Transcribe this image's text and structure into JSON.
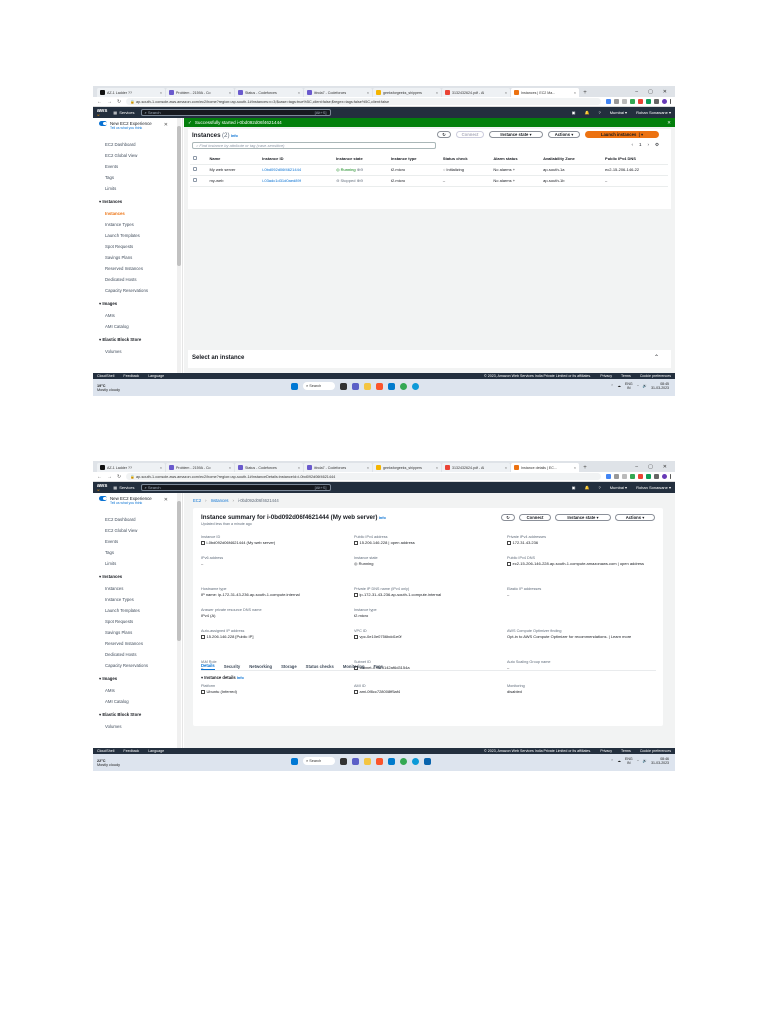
{
  "tabs": [
    {
      "label": "AZ-1 Ladder ??",
      "fav": "#111"
    },
    {
      "label": "Problem - 2159A - Co",
      "fav": "#6a5acd"
    },
    {
      "label": "Status - Codeforces",
      "fav": "#6a5acd"
    },
    {
      "label": "iitrola7 - Codeforces",
      "fav": "#6a5acd"
    },
    {
      "label": "geeksforgeeks_shippers",
      "fav": "#f4b400"
    },
    {
      "label": "3132432624.pdf - Al",
      "fav": "#ea4335"
    },
    {
      "label": "Instances | EC2 Ma...",
      "fav": "#ec7211"
    }
  ],
  "tabs2_active": "Instance details | EC...",
  "url1": "ap-south-1.console.aws.amazon.com/ec2/home?region=ap-south-1#Instances:v=3;$case=tags:true%5C,client:false;$regex=tags:false%5C,client:false",
  "url2": "ap-south-1.console.aws.amazon.com/ec2/home?region=ap-south-1#InstanceDetails:instanceId=i-0bd092d06f4621444",
  "aws": {
    "services": "Services",
    "search": "Search",
    "hotkey": "[Alt+S]",
    "region": "Mumbai",
    "user": "Rohan Sonawane"
  },
  "sidebar": {
    "new_exp": "New EC2 Experience",
    "tell_us": "Tell us what you think",
    "top": [
      "EC2 Dashboard",
      "EC2 Global View",
      "Events",
      "Tags",
      "Limits"
    ],
    "instances_head": "Instances",
    "instances": [
      "Instances",
      "Instance Types",
      "Launch Templates",
      "Spot Requests",
      "Savings Plans",
      "Reserved Instances",
      "Dedicated Hosts",
      "Capacity Reservations"
    ],
    "images_head": "Images",
    "images": [
      "AMIs",
      "AMI Catalog"
    ],
    "ebs_head": "Elastic Block Store",
    "ebs": [
      "Volumes"
    ]
  },
  "shot1": {
    "flash": "Successfully started i-0bd092d06f4621444",
    "title": "Instances",
    "count": "(2)",
    "info": "Info",
    "refresh": "C",
    "connect": "Connect",
    "state_btn": "Instance state",
    "actions": "Actions",
    "launch": "Launch instances",
    "filter": "Find instance by attribute or tag (case-sensitive)",
    "page": "1",
    "columns": [
      "Name",
      "Instance ID",
      "Instance state",
      "Instance type",
      "Status check",
      "Alarm status",
      "Availability Zone",
      "Public IPv4 DNS"
    ],
    "rows": [
      {
        "name": "My web server",
        "id": "i-0bd092d06f4621444",
        "state": "Running",
        "type": "t2.micro",
        "check": "Initializing",
        "alarm": "No alarms",
        "az": "ap-south-1a",
        "dns": "ec2-15-206-146-22"
      },
      {
        "name": "my-web",
        "id": "i-03adc1d31d0aed89f",
        "state": "Stopped",
        "type": "t2.micro",
        "check": "–",
        "alarm": "No alarms",
        "az": "ap-south-1b",
        "dns": "–"
      }
    ],
    "select": "Select an instance"
  },
  "shot2": {
    "crumbs": [
      "EC2",
      "Instances",
      "i-0bd092d06f4621444"
    ],
    "title": "Instance summary for i-0bd092d06f4621444 (My web server)",
    "info": "Info",
    "updated": "Updated less than a minute ago",
    "connect": "Connect",
    "state_btn": "Instance state",
    "actions": "Actions",
    "fields": {
      "instance_id_l": "Instance ID",
      "instance_id_v": "i-0bd092d06f4621444 (My web server)",
      "public_ip_l": "Public IPv4 address",
      "public_ip_v": "15.206.146.228 | open address",
      "private_ip_l": "Private IPv4 addresses",
      "private_ip_v": "172.31.43.236",
      "ipv6_l": "IPv6 address",
      "ipv6_v": "–",
      "state_l": "Instance state",
      "state_v": "Running",
      "pubdns_l": "Public IPv4 DNS",
      "pubdns_v": "ec2-15-206-146-228.ap-south-1.compute.amazonaws.com | open address",
      "hostname_l": "Hostname type",
      "hostname_v": "IP name: ip-172-31-43-236.ap-south-1.compute.internal",
      "privdns_l": "Private IP DNS name (IPv4 only)",
      "privdns_v": "ip-172-31-43-236.ap-south-1.compute.internal",
      "eip_l": "Elastic IP addresses",
      "eip_v": "–",
      "answer_l": "Answer private resource DNS name",
      "answer_v": "IPv4 (A)",
      "itype_l": "Instance type",
      "itype_v": "t2.micro",
      "optim_l": "AWS Compute Optimizer finding",
      "optim_v": "Opt-in to AWS Compute Optimizer for recommendations. | Learn more",
      "autoip_l": "Auto-assigned IP address",
      "autoip_v": "15.206.146.228 [Public IP]",
      "vpc_l": "VPC ID",
      "vpc_v": "vpc-0e10e0756bdd1e0f",
      "iam_l": "IAM Role",
      "iam_v": "–",
      "subnet_l": "Subnet ID",
      "subnet_v": "subnet-07815142af6d3154a",
      "asg_l": "Auto Scaling Group name",
      "asg_v": "–"
    },
    "tabs": [
      "Details",
      "Security",
      "Networking",
      "Storage",
      "Status checks",
      "Monitoring",
      "Tags"
    ],
    "details_head": "Instance details",
    "platform_l": "Platform",
    "platform_v": "Ubuntu (Inferred)",
    "ami_l": "AMI ID",
    "ami_v": "ami-0f8cc728008ff5af4",
    "mon_l": "Monitoring",
    "mon_v": "disabled"
  },
  "footer": {
    "cloudshell": "CloudShell",
    "feedback": "Feedback",
    "language": "Language",
    "copy": "© 2023, Amazon Web Services India Private Limited or its affiliates.",
    "privacy": "Privacy",
    "terms": "Terms",
    "cookie": "Cookie preferences"
  },
  "taskbar": {
    "temp1": "19°C",
    "temp2": "22°C",
    "weather": "Mostly cloudy",
    "search": "Search",
    "lang": "ENG",
    "lang2": "IN",
    "time1": "08:45",
    "time2": "08:46",
    "date": "31-03-2023"
  }
}
